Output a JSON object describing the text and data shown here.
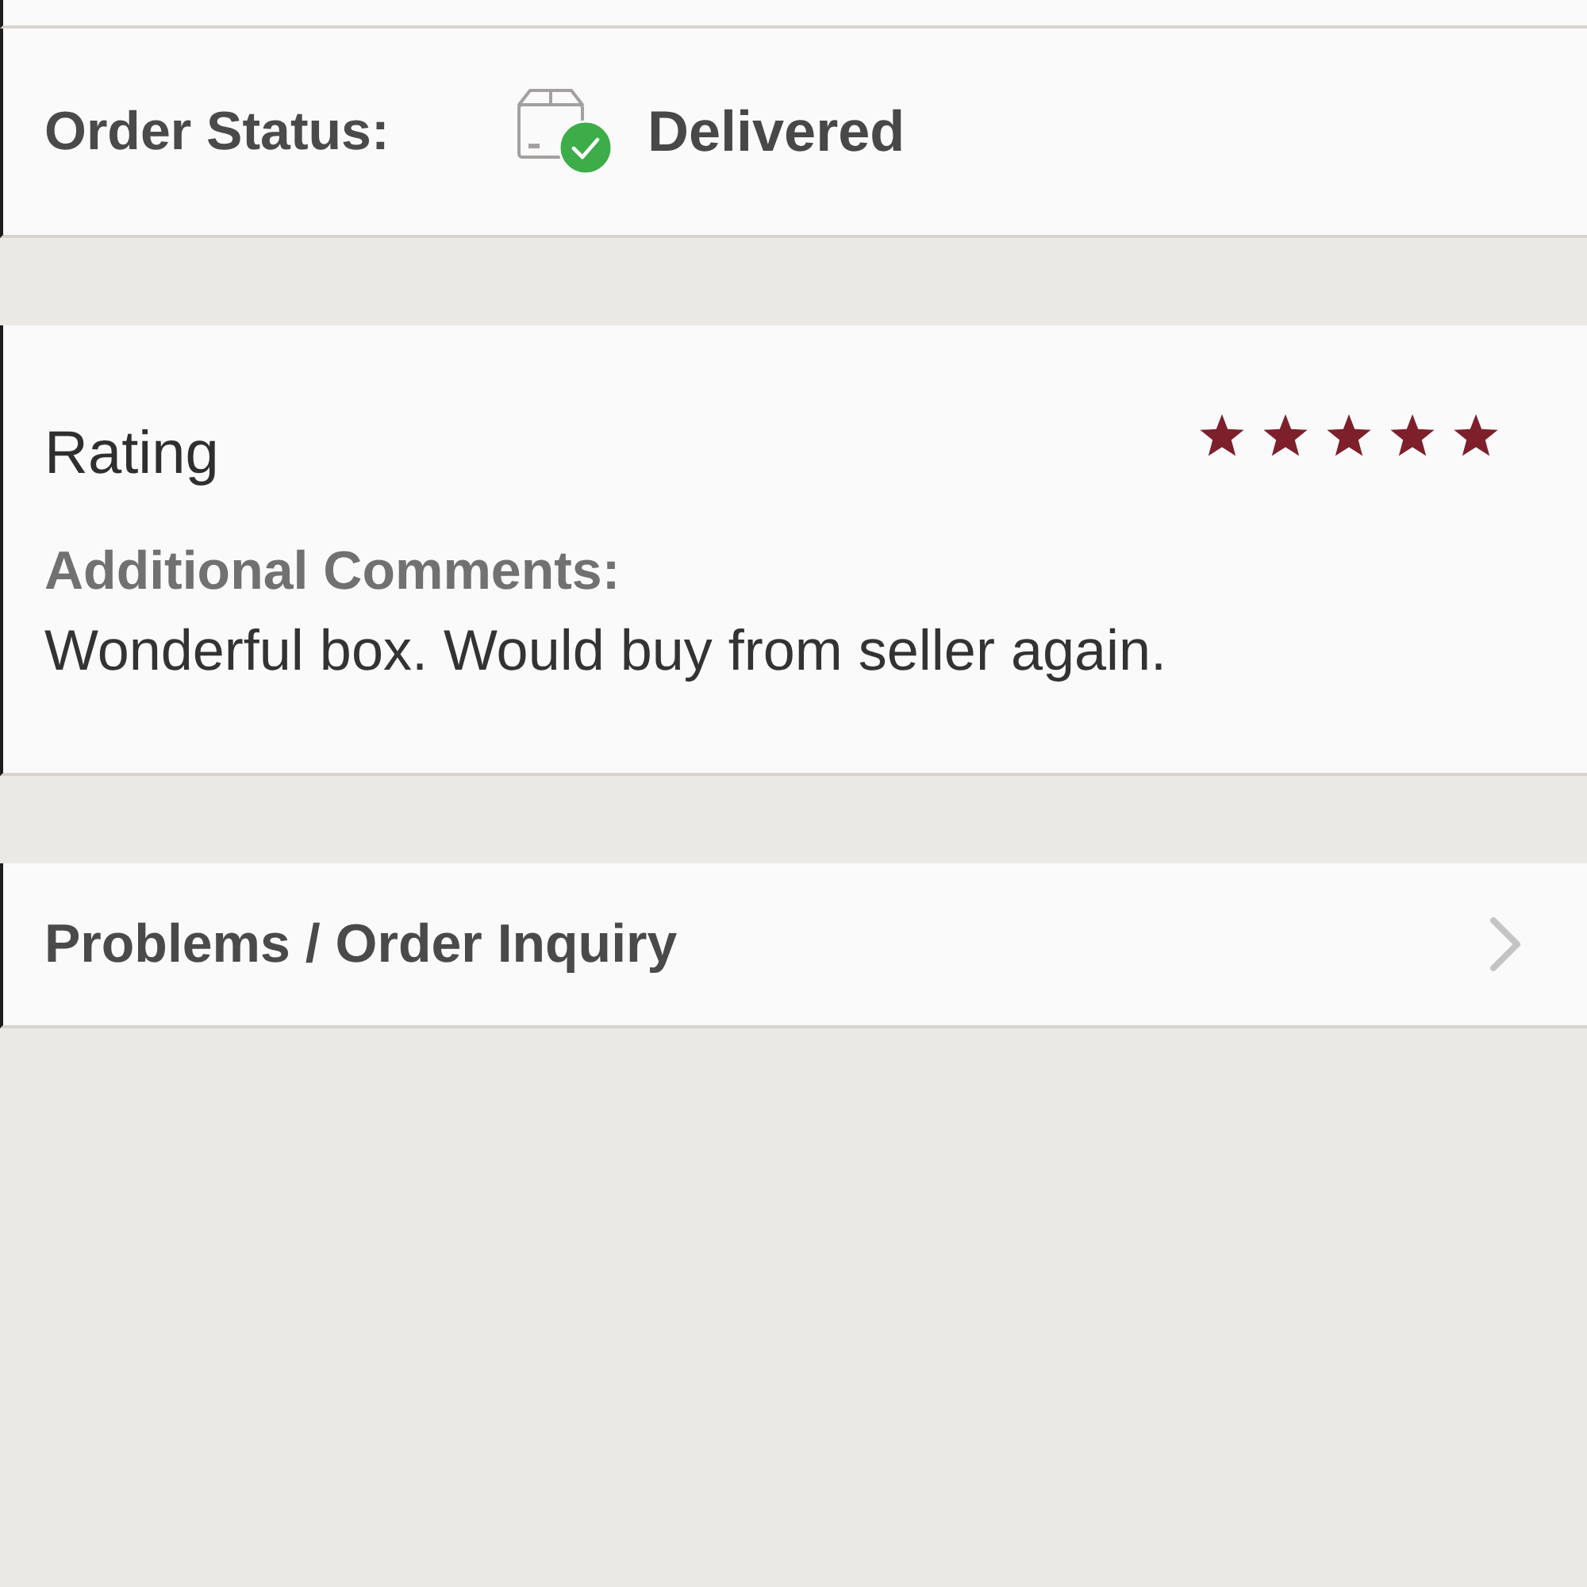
{
  "order_status": {
    "label": "Order Status:",
    "value": "Delivered"
  },
  "rating": {
    "title": "Rating",
    "stars": 5,
    "comments_label": "Additional Comments:",
    "comment": "Wonderful box. Would buy from seller again."
  },
  "inquiry": {
    "label": "Problems / Order Inquiry"
  }
}
